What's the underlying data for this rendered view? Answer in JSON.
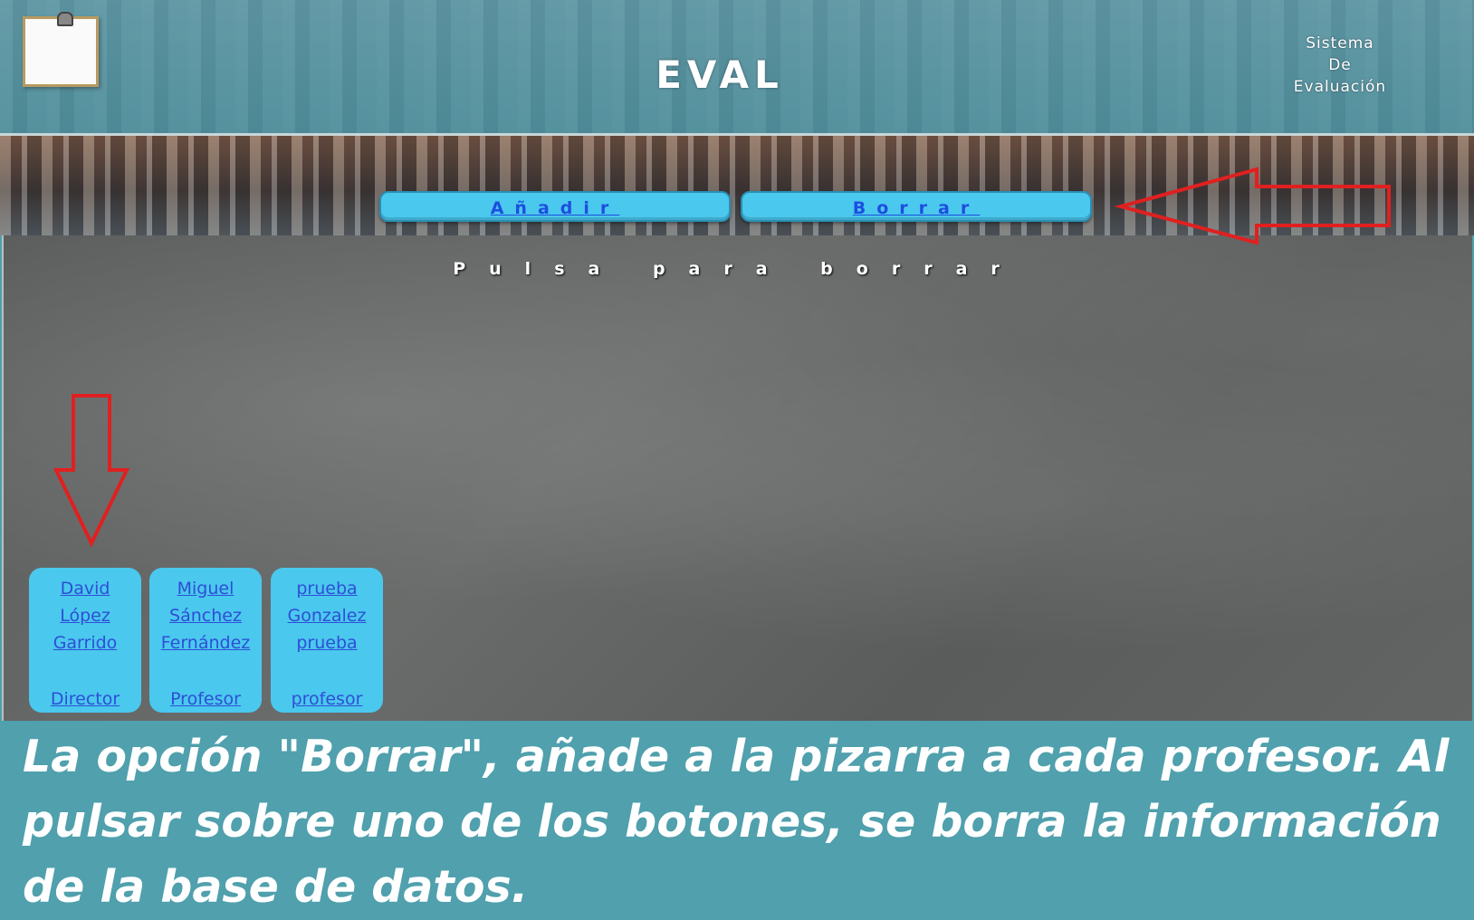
{
  "header": {
    "brand": "EVAL",
    "tagline": [
      "Sistema",
      "De",
      "Evaluación"
    ]
  },
  "nav": {
    "add_label": "Añadir",
    "delete_label": "Borrar"
  },
  "board": {
    "title": "Pulsa para borrar",
    "cards": [
      {
        "name": [
          "David",
          "López",
          "Garrido"
        ],
        "role": "Director"
      },
      {
        "name": [
          "Miguel",
          "Sánchez",
          "Fernández"
        ],
        "role": "Profesor"
      },
      {
        "name": [
          "prueba",
          "Gonzalez",
          "prueba"
        ],
        "role": "profesor"
      }
    ]
  },
  "caption": "La opción \"Borrar\", añade a la pizarra a cada profesor. Al pulsar sobre uno de los botones, se borra la información de la base de datos.",
  "colors": {
    "button": "#4ac8ee",
    "link": "#2e4fd6",
    "annotation_arrow": "#e02020",
    "caption_bg": "#50a0ad"
  }
}
